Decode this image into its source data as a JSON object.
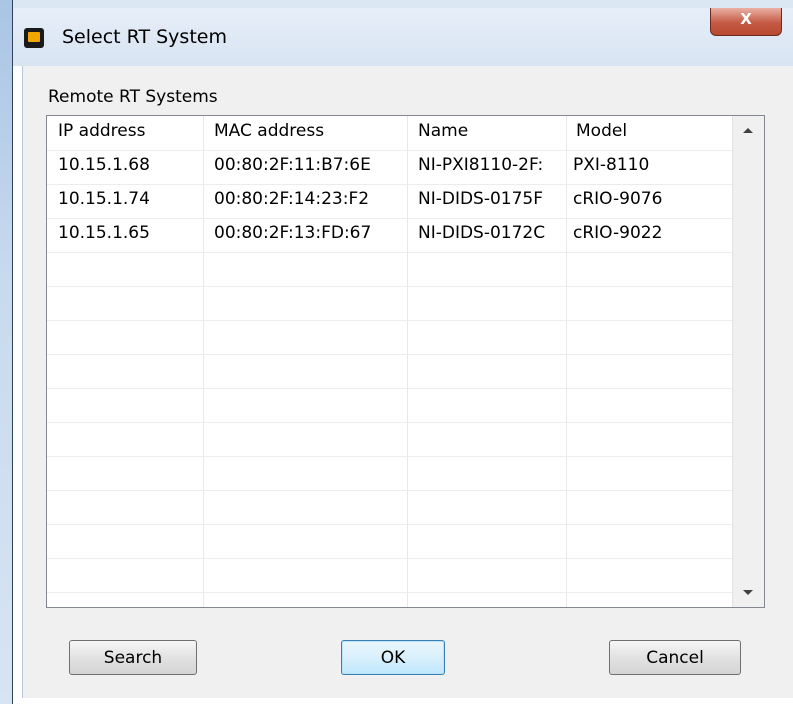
{
  "window": {
    "title": "Select RT System",
    "close_glyph": "X"
  },
  "group": {
    "label": "Remote RT Systems"
  },
  "table": {
    "columns": [
      "IP address",
      "MAC address",
      "Name",
      "Model"
    ],
    "rows": [
      [
        "10.15.1.68",
        "00:80:2F:11:B7:6E",
        "NI-PXI8110-2F:",
        "PXI-8110"
      ],
      [
        "10.15.1.74",
        "00:80:2F:14:23:F2",
        "NI-DIDS-0175F",
        "cRIO-9076"
      ],
      [
        "10.15.1.65",
        "00:80:2F:13:FD:67",
        "NI-DIDS-0172C",
        "cRIO-9022"
      ]
    ]
  },
  "buttons": {
    "search": "Search",
    "ok": "OK",
    "cancel": "Cancel"
  },
  "icons": {
    "app": "rt-system-icon",
    "close": "close-icon",
    "scroll_up": "chevron-up-icon",
    "scroll_down": "chevron-down-icon"
  },
  "colors": {
    "close_button": "#c45a45",
    "default_button_border": "#3c7fb1",
    "dialog_background": "#f0f0f0"
  }
}
